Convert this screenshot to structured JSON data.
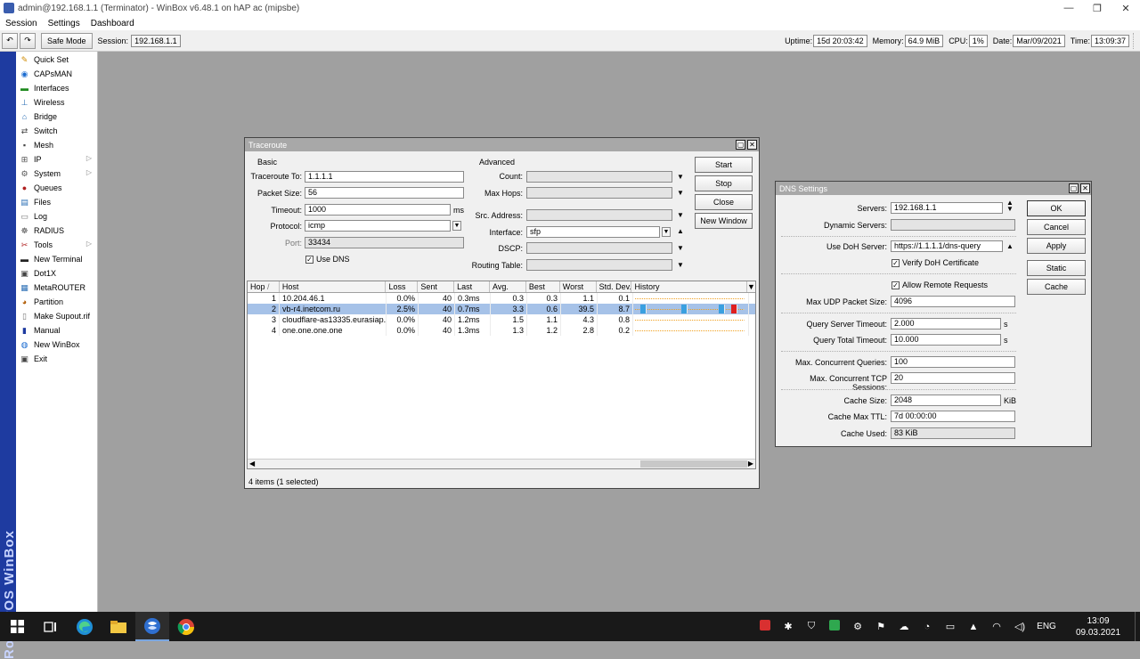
{
  "window": {
    "title": "admin@192.168.1.1 (Terminator) - WinBox v6.48.1 on hAP ac (mipsbe)",
    "minimize": "—",
    "maximize": "❐",
    "close": "✕"
  },
  "menu": [
    "Session",
    "Settings",
    "Dashboard"
  ],
  "toolbar": {
    "undo": "↶",
    "redo": "↷",
    "safe_mode": "Safe Mode",
    "session_label": "Session:",
    "session_value": "192.168.1.1",
    "uptime_label": "Uptime:",
    "uptime_value": "15d 20:03:42",
    "memory_label": "Memory:",
    "memory_value": "64.9 MiB",
    "cpu_label": "CPU:",
    "cpu_value": "1%",
    "date_label": "Date:",
    "date_value": "Mar/09/2021",
    "time_label": "Time:",
    "time_value": "13:09:37"
  },
  "sidebar": {
    "vertical_text": "RouterOS WinBox",
    "items": [
      {
        "label": "Quick Set",
        "icon": "quickset-icon",
        "glyph": "✎",
        "color": "#d08a00",
        "arrow": ""
      },
      {
        "label": "CAPsMAN",
        "icon": "capsman-icon",
        "glyph": "◉",
        "color": "#1a6bd0",
        "arrow": ""
      },
      {
        "label": "Interfaces",
        "icon": "interfaces-icon",
        "glyph": "▬",
        "color": "#1e8a1e",
        "arrow": ""
      },
      {
        "label": "Wireless",
        "icon": "wireless-icon",
        "glyph": "⊥",
        "color": "#2b6fb5",
        "arrow": ""
      },
      {
        "label": "Bridge",
        "icon": "bridge-icon",
        "glyph": "⌂",
        "color": "#2b6fb5",
        "arrow": ""
      },
      {
        "label": "Switch",
        "icon": "switch-icon",
        "glyph": "⇄",
        "color": "#444",
        "arrow": ""
      },
      {
        "label": "Mesh",
        "icon": "mesh-icon",
        "glyph": "▪",
        "color": "#444",
        "arrow": ""
      },
      {
        "label": "IP",
        "icon": "ip-icon",
        "glyph": "⊞",
        "color": "#555",
        "arrow": "▷"
      },
      {
        "label": "System",
        "icon": "system-icon",
        "glyph": "⚙",
        "color": "#555",
        "arrow": "▷"
      },
      {
        "label": "Queues",
        "icon": "queues-icon",
        "glyph": "●",
        "color": "#b02020",
        "arrow": ""
      },
      {
        "label": "Files",
        "icon": "files-icon",
        "glyph": "▤",
        "color": "#2b6fb5",
        "arrow": ""
      },
      {
        "label": "Log",
        "icon": "log-icon",
        "glyph": "▭",
        "color": "#777",
        "arrow": ""
      },
      {
        "label": "RADIUS",
        "icon": "radius-icon",
        "glyph": "☸",
        "color": "#555",
        "arrow": ""
      },
      {
        "label": "Tools",
        "icon": "tools-icon",
        "glyph": "✂",
        "color": "#b02020",
        "arrow": "▷"
      },
      {
        "label": "New Terminal",
        "icon": "terminal-icon",
        "glyph": "▬",
        "color": "#222",
        "arrow": ""
      },
      {
        "label": "Dot1X",
        "icon": "dot1x-icon",
        "glyph": "▣",
        "color": "#444",
        "arrow": ""
      },
      {
        "label": "MetaROUTER",
        "icon": "metarouter-icon",
        "glyph": "▦",
        "color": "#2b6fb5",
        "arrow": ""
      },
      {
        "label": "Partition",
        "icon": "partition-icon",
        "glyph": "◕",
        "color": "#b05a00",
        "arrow": ""
      },
      {
        "label": "Make Supout.rif",
        "icon": "supout-icon",
        "glyph": "▯",
        "color": "#777",
        "arrow": ""
      },
      {
        "label": "Manual",
        "icon": "manual-icon",
        "glyph": "▮",
        "color": "#1e3ba0",
        "arrow": ""
      },
      {
        "label": "New WinBox",
        "icon": "winbox-icon",
        "glyph": "◍",
        "color": "#1a6bd0",
        "arrow": ""
      },
      {
        "label": "Exit",
        "icon": "exit-icon",
        "glyph": "▣",
        "color": "#444",
        "arrow": ""
      }
    ]
  },
  "traceroute": {
    "title": "Traceroute",
    "basic_header": "Basic",
    "advanced_header": "Advanced",
    "traceroute_to_label": "Traceroute To:",
    "traceroute_to": "1.1.1.1",
    "packet_size_label": "Packet Size:",
    "packet_size": "56",
    "timeout_label": "Timeout:",
    "timeout": "1000",
    "timeout_unit": "ms",
    "protocol_label": "Protocol:",
    "protocol": "icmp",
    "port_label": "Port:",
    "port": "33434",
    "use_dns_label": "Use DNS",
    "count_label": "Count:",
    "max_hops_label": "Max Hops:",
    "src_address_label": "Src. Address:",
    "interface_label": "Interface:",
    "interface": "sfp",
    "dscp_label": "DSCP:",
    "routing_table_label": "Routing Table:",
    "buttons": {
      "start": "Start",
      "stop": "Stop",
      "close": "Close",
      "new_window": "New Window"
    },
    "columns": [
      "Hop",
      "Host",
      "Loss",
      "Sent",
      "Last",
      "Avg.",
      "Best",
      "Worst",
      "Std. Dev.",
      "History"
    ],
    "hop_sort_mark": "/",
    "rows": [
      {
        "hop": "1",
        "host": "10.204.46.1",
        "loss": "0.0%",
        "sent": "40",
        "last": "0.3ms",
        "avg": "0.3",
        "best": "0.3",
        "worst": "1.1",
        "std": "0.1",
        "selected": false
      },
      {
        "hop": "2",
        "host": "vb-r4.inetcom.ru",
        "loss": "2.5%",
        "sent": "40",
        "last": "0.7ms",
        "avg": "3.3",
        "best": "0.6",
        "worst": "39.5",
        "std": "8.7",
        "selected": true
      },
      {
        "hop": "3",
        "host": "cloudflare-as13335.eurasiap...",
        "loss": "0.0%",
        "sent": "40",
        "last": "1.2ms",
        "avg": "1.5",
        "best": "1.1",
        "worst": "4.3",
        "std": "0.8",
        "selected": false
      },
      {
        "hop": "4",
        "host": "one.one.one.one",
        "loss": "0.0%",
        "sent": "40",
        "last": "1.3ms",
        "avg": "1.3",
        "best": "1.2",
        "worst": "2.8",
        "std": "0.2",
        "selected": false
      }
    ],
    "status": "4 items (1 selected)"
  },
  "dns": {
    "title": "DNS Settings",
    "servers_label": "Servers:",
    "servers": "192.168.1.1",
    "dynamic_servers_label": "Dynamic Servers:",
    "use_doh_label": "Use DoH Server:",
    "use_doh": "https://1.1.1.1/dns-query",
    "verify_doh_label": "Verify DoH Certificate",
    "allow_remote_label": "Allow Remote Requests",
    "max_udp_label": "Max UDP Packet Size:",
    "max_udp": "4096",
    "query_server_timeout_label": "Query Server Timeout:",
    "query_server_timeout": "2.000",
    "query_total_timeout_label": "Query Total Timeout:",
    "query_total_timeout": "10.000",
    "seconds_unit": "s",
    "max_concurrent_label": "Max. Concurrent Queries:",
    "max_concurrent": "100",
    "max_tcp_label": "Max. Concurrent TCP Sessions:",
    "max_tcp": "20",
    "cache_size_label": "Cache Size:",
    "cache_size": "2048",
    "cache_size_unit": "KiB",
    "cache_ttl_label": "Cache Max TTL:",
    "cache_ttl": "7d 00:00:00",
    "cache_used_label": "Cache Used:",
    "cache_used": "83 KiB",
    "buttons": {
      "ok": "OK",
      "cancel": "Cancel",
      "apply": "Apply",
      "static": "Static",
      "cache": "Cache"
    }
  },
  "taskbar": {
    "lang": "ENG",
    "time": "13:09",
    "date": "09.03.2021"
  }
}
